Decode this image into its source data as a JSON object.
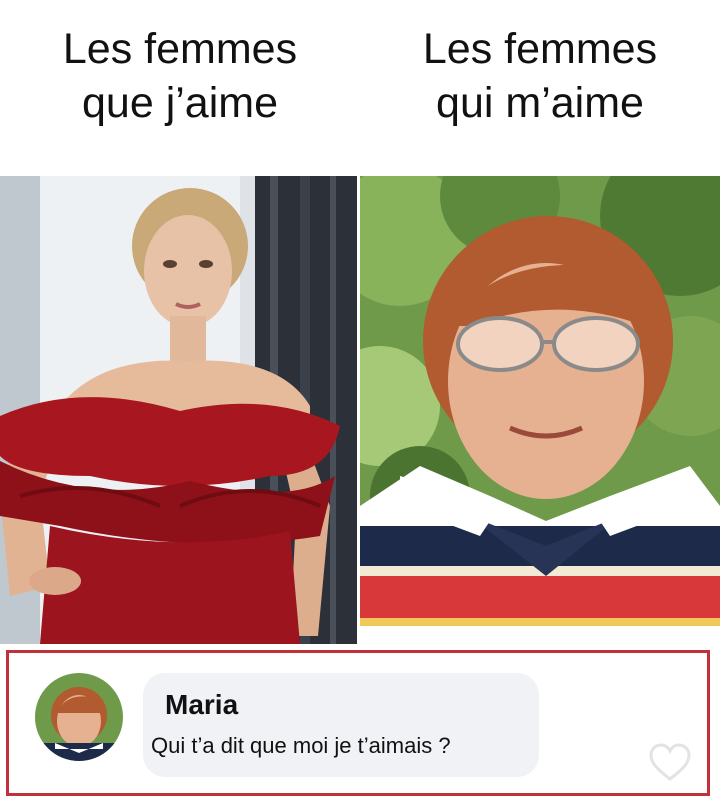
{
  "captions": {
    "left": {
      "line1": "Les femmes",
      "line2": "que j’aime"
    },
    "right": {
      "line1": "Les femmes",
      "line2": "qui m’aime"
    }
  },
  "photos": {
    "left": {
      "subject": "woman in red off-shoulder dress"
    },
    "right": {
      "subject": "woman with glasses and striped polo shirt"
    }
  },
  "comment": {
    "author": "Maria",
    "text": "Qui t’a dit que moi je t’aimais ?",
    "icons": {
      "avatar": "avatar",
      "reaction": "heart-icon"
    }
  },
  "colors": {
    "frame_border": "#c0313a",
    "bubble_bg": "#f0f2f5",
    "dress_red": "#a8161f"
  }
}
